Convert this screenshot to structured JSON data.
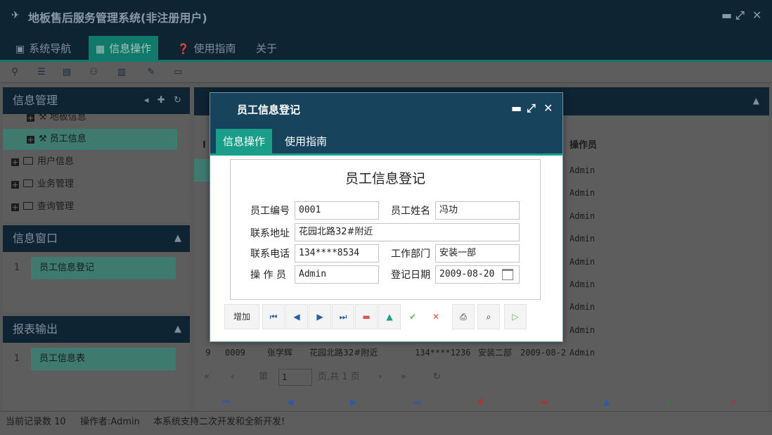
{
  "window": {
    "title": "地板售后服务管理系统(非注册用户)"
  },
  "menu": {
    "items": [
      "系统导航",
      "信息操作",
      "使用指南",
      "关于"
    ]
  },
  "left": {
    "info_mgmt": {
      "title": "信息管理",
      "tree": [
        "地板信息",
        "员工信息",
        "用户信息",
        "业务管理",
        "查询管理"
      ]
    },
    "info_window": {
      "title": "信息窗口",
      "rows": [
        {
          "num": "1",
          "label": "员工信息登记"
        }
      ]
    },
    "report": {
      "title": "报表输出",
      "rows": [
        {
          "num": "1",
          "label": "员工信息表"
        }
      ]
    }
  },
  "grid": {
    "col_first": "I",
    "col_operator": "操作员",
    "rows": [
      {
        "operator": "Admin"
      },
      {
        "operator": "Admin"
      },
      {
        "operator": "Admin"
      },
      {
        "operator": "Admin"
      },
      {
        "operator": "Admin"
      },
      {
        "operator": "Admin"
      },
      {
        "operator": "Admin"
      },
      {
        "operator": "Admin"
      },
      {
        "num": "9",
        "id": "0009",
        "name": "张学辉",
        "addr": "花园北路32#附近",
        "phone": "134****1236",
        "dept": "安装二部",
        "date": "2009-08-2",
        "operator": "Admin"
      }
    ],
    "pager": {
      "page_label": "第",
      "page_value": "1",
      "total": "页,共 1 页"
    }
  },
  "status": {
    "record_count": "当前记录数 10",
    "operator": "操作者:Admin",
    "note": "本系统支持二次开发和全新开发!"
  },
  "modal": {
    "title": "员工信息登记",
    "tabs": [
      "信息操作",
      "使用指南"
    ],
    "form_title": "员工信息登记",
    "fields": {
      "emp_no": {
        "label": "员工编号",
        "value": "0001"
      },
      "emp_name": {
        "label": "员工姓名",
        "value": "冯功"
      },
      "address": {
        "label": "联系地址",
        "value": "花园北路32#附近"
      },
      "phone": {
        "label": "联系电话",
        "value": "134****8534"
      },
      "dept": {
        "label": "工作部门",
        "value": "安装一部"
      },
      "operator": {
        "label": "操 作 员",
        "value": "Admin"
      },
      "reg_date": {
        "label": "登记日期",
        "value": "2009-08-20"
      }
    },
    "buttons": {
      "add": "增加"
    }
  },
  "colors": {
    "header_bg": "#0e2433",
    "accent": "#1a9e8a",
    "modal_bg": "#17435d",
    "nav_blue": "#2b5aa6",
    "delete_red": "#d9534f",
    "save_green": "#5cb85c"
  }
}
